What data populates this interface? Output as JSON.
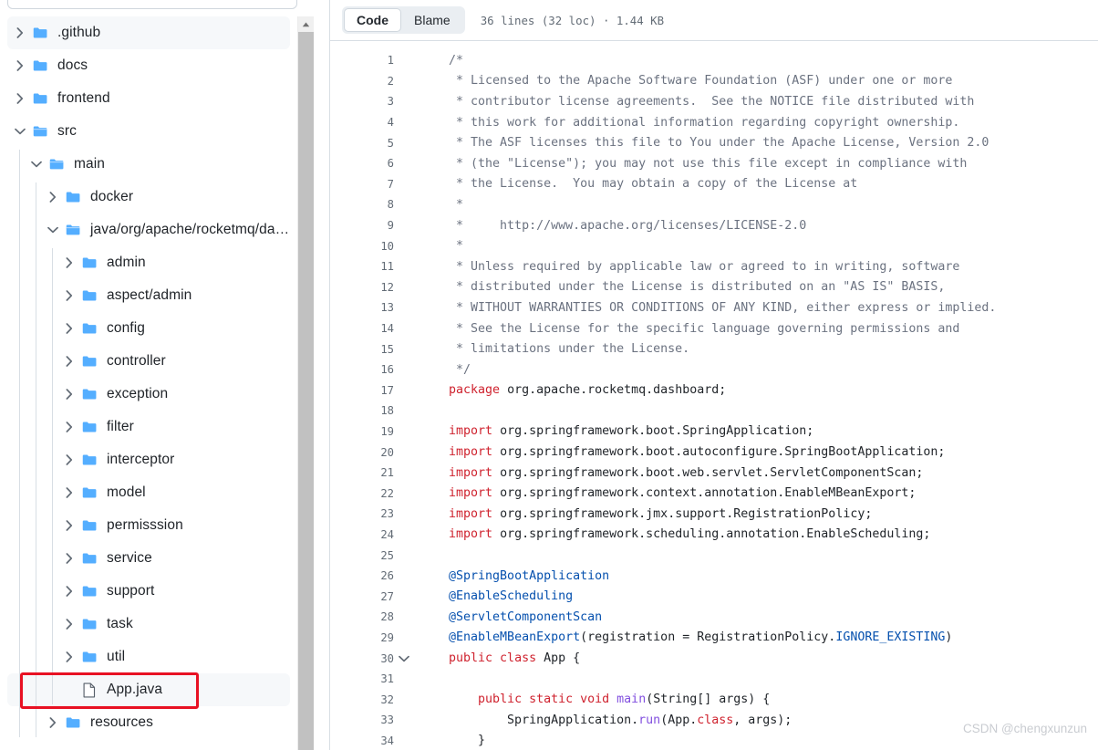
{
  "sidebar": {
    "search": {
      "value": "",
      "placeholder": ""
    },
    "tree": [
      {
        "label": ".github",
        "type": "folder",
        "state": "collapsed",
        "depth": 0,
        "selected": true
      },
      {
        "label": "docs",
        "type": "folder",
        "state": "collapsed",
        "depth": 0,
        "selected": false
      },
      {
        "label": "frontend",
        "type": "folder",
        "state": "collapsed",
        "depth": 0,
        "selected": false
      },
      {
        "label": "src",
        "type": "folder",
        "state": "expanded",
        "depth": 0,
        "selected": false
      },
      {
        "label": "main",
        "type": "folder",
        "state": "expanded",
        "depth": 1,
        "selected": false
      },
      {
        "label": "docker",
        "type": "folder",
        "state": "collapsed",
        "depth": 2,
        "selected": false
      },
      {
        "label": "java/org/apache/rocketmq/da…",
        "type": "folder",
        "state": "expanded",
        "depth": 2,
        "selected": false
      },
      {
        "label": "admin",
        "type": "folder",
        "state": "collapsed",
        "depth": 3,
        "selected": false
      },
      {
        "label": "aspect/admin",
        "type": "folder",
        "state": "collapsed",
        "depth": 3,
        "selected": false
      },
      {
        "label": "config",
        "type": "folder",
        "state": "collapsed",
        "depth": 3,
        "selected": false
      },
      {
        "label": "controller",
        "type": "folder",
        "state": "collapsed",
        "depth": 3,
        "selected": false
      },
      {
        "label": "exception",
        "type": "folder",
        "state": "collapsed",
        "depth": 3,
        "selected": false
      },
      {
        "label": "filter",
        "type": "folder",
        "state": "collapsed",
        "depth": 3,
        "selected": false
      },
      {
        "label": "interceptor",
        "type": "folder",
        "state": "collapsed",
        "depth": 3,
        "selected": false
      },
      {
        "label": "model",
        "type": "folder",
        "state": "collapsed",
        "depth": 3,
        "selected": false
      },
      {
        "label": "permisssion",
        "type": "folder",
        "state": "collapsed",
        "depth": 3,
        "selected": false
      },
      {
        "label": "service",
        "type": "folder",
        "state": "collapsed",
        "depth": 3,
        "selected": false
      },
      {
        "label": "support",
        "type": "folder",
        "state": "collapsed",
        "depth": 3,
        "selected": false
      },
      {
        "label": "task",
        "type": "folder",
        "state": "collapsed",
        "depth": 3,
        "selected": false
      },
      {
        "label": "util",
        "type": "folder",
        "state": "collapsed",
        "depth": 3,
        "selected": false
      },
      {
        "label": "App.java",
        "type": "file",
        "state": "none",
        "depth": 3,
        "selected": true
      },
      {
        "label": "resources",
        "type": "folder",
        "state": "collapsed",
        "depth": 2,
        "selected": false
      }
    ],
    "annotation": {
      "color": "#e81123",
      "target": "App.java"
    },
    "scrollbar": {
      "up_icon": "scroll-up-arrow"
    }
  },
  "code_view": {
    "tabs": [
      {
        "label": "Code",
        "active": true
      },
      {
        "label": "Blame",
        "active": false
      }
    ],
    "meta": "36 lines (32 loc) · 1.44 KB",
    "lines": [
      {
        "n": 1,
        "fold": false,
        "tokens": [
          {
            "t": "  ",
            "c": "pl"
          },
          {
            "t": "/*",
            "c": "com"
          }
        ]
      },
      {
        "n": 2,
        "fold": false,
        "tokens": [
          {
            "t": "   * Licensed to the Apache Software Foundation (ASF) under one or more",
            "c": "com"
          }
        ]
      },
      {
        "n": 3,
        "fold": false,
        "tokens": [
          {
            "t": "   * contributor license agreements.  See the NOTICE file distributed with",
            "c": "com"
          }
        ]
      },
      {
        "n": 4,
        "fold": false,
        "tokens": [
          {
            "t": "   * this work for additional information regarding copyright ownership.",
            "c": "com"
          }
        ]
      },
      {
        "n": 5,
        "fold": false,
        "tokens": [
          {
            "t": "   * The ASF licenses this file to You under the Apache License, Version 2.0",
            "c": "com"
          }
        ]
      },
      {
        "n": 6,
        "fold": false,
        "tokens": [
          {
            "t": "   * (the \"License\"); you may not use this file except in compliance with",
            "c": "com"
          }
        ]
      },
      {
        "n": 7,
        "fold": false,
        "tokens": [
          {
            "t": "   * the License.  You may obtain a copy of the License at",
            "c": "com"
          }
        ]
      },
      {
        "n": 8,
        "fold": false,
        "tokens": [
          {
            "t": "   *",
            "c": "com"
          }
        ]
      },
      {
        "n": 9,
        "fold": false,
        "tokens": [
          {
            "t": "   *     http://www.apache.org/licenses/LICENSE-2.0",
            "c": "com"
          }
        ]
      },
      {
        "n": 10,
        "fold": false,
        "tokens": [
          {
            "t": "   *",
            "c": "com"
          }
        ]
      },
      {
        "n": 11,
        "fold": false,
        "tokens": [
          {
            "t": "   * Unless required by applicable law or agreed to in writing, software",
            "c": "com"
          }
        ]
      },
      {
        "n": 12,
        "fold": false,
        "tokens": [
          {
            "t": "   * distributed under the License is distributed on an \"AS IS\" BASIS,",
            "c": "com"
          }
        ]
      },
      {
        "n": 13,
        "fold": false,
        "tokens": [
          {
            "t": "   * WITHOUT WARRANTIES OR CONDITIONS OF ANY KIND, either express or implied.",
            "c": "com"
          }
        ]
      },
      {
        "n": 14,
        "fold": false,
        "tokens": [
          {
            "t": "   * See the License for the specific language governing permissions and",
            "c": "com"
          }
        ]
      },
      {
        "n": 15,
        "fold": false,
        "tokens": [
          {
            "t": "   * limitations under the License.",
            "c": "com"
          }
        ]
      },
      {
        "n": 16,
        "fold": false,
        "tokens": [
          {
            "t": "   */",
            "c": "com"
          }
        ]
      },
      {
        "n": 17,
        "fold": false,
        "tokens": [
          {
            "t": "  ",
            "c": "pl"
          },
          {
            "t": "package",
            "c": "kw"
          },
          {
            "t": " org.apache.rocketmq.dashboard;",
            "c": "pl"
          }
        ]
      },
      {
        "n": 18,
        "fold": false,
        "tokens": []
      },
      {
        "n": 19,
        "fold": false,
        "tokens": [
          {
            "t": "  ",
            "c": "pl"
          },
          {
            "t": "import",
            "c": "kw"
          },
          {
            "t": " org.springframework.boot.SpringApplication;",
            "c": "pl"
          }
        ]
      },
      {
        "n": 20,
        "fold": false,
        "tokens": [
          {
            "t": "  ",
            "c": "pl"
          },
          {
            "t": "import",
            "c": "kw"
          },
          {
            "t": " org.springframework.boot.autoconfigure.SpringBootApplication;",
            "c": "pl"
          }
        ]
      },
      {
        "n": 21,
        "fold": false,
        "tokens": [
          {
            "t": "  ",
            "c": "pl"
          },
          {
            "t": "import",
            "c": "kw"
          },
          {
            "t": " org.springframework.boot.web.servlet.ServletComponentScan;",
            "c": "pl"
          }
        ]
      },
      {
        "n": 22,
        "fold": false,
        "tokens": [
          {
            "t": "  ",
            "c": "pl"
          },
          {
            "t": "import",
            "c": "kw"
          },
          {
            "t": " org.springframework.context.annotation.EnableMBeanExport;",
            "c": "pl"
          }
        ]
      },
      {
        "n": 23,
        "fold": false,
        "tokens": [
          {
            "t": "  ",
            "c": "pl"
          },
          {
            "t": "import",
            "c": "kw"
          },
          {
            "t": " org.springframework.jmx.support.RegistrationPolicy;",
            "c": "pl"
          }
        ]
      },
      {
        "n": 24,
        "fold": false,
        "tokens": [
          {
            "t": "  ",
            "c": "pl"
          },
          {
            "t": "import",
            "c": "kw"
          },
          {
            "t": " org.springframework.scheduling.annotation.EnableScheduling;",
            "c": "pl"
          }
        ]
      },
      {
        "n": 25,
        "fold": false,
        "tokens": []
      },
      {
        "n": 26,
        "fold": false,
        "tokens": [
          {
            "t": "  ",
            "c": "pl"
          },
          {
            "t": "@SpringBootApplication",
            "c": "ann"
          }
        ]
      },
      {
        "n": 27,
        "fold": false,
        "tokens": [
          {
            "t": "  ",
            "c": "pl"
          },
          {
            "t": "@EnableScheduling",
            "c": "ann"
          }
        ]
      },
      {
        "n": 28,
        "fold": false,
        "tokens": [
          {
            "t": "  ",
            "c": "pl"
          },
          {
            "t": "@ServletComponentScan",
            "c": "ann"
          }
        ]
      },
      {
        "n": 29,
        "fold": false,
        "tokens": [
          {
            "t": "  ",
            "c": "pl"
          },
          {
            "t": "@EnableMBeanExport",
            "c": "ann"
          },
          {
            "t": "(registration = RegistrationPolicy.",
            "c": "pl"
          },
          {
            "t": "IGNORE_EXISTING",
            "c": "con"
          },
          {
            "t": ")",
            "c": "pl"
          }
        ]
      },
      {
        "n": 30,
        "fold": true,
        "tokens": [
          {
            "t": "  ",
            "c": "pl"
          },
          {
            "t": "public class",
            "c": "kw"
          },
          {
            "t": " App {",
            "c": "pl"
          }
        ]
      },
      {
        "n": 31,
        "fold": false,
        "tokens": []
      },
      {
        "n": 32,
        "fold": false,
        "tokens": [
          {
            "t": "      ",
            "c": "pl"
          },
          {
            "t": "public static void",
            "c": "kw"
          },
          {
            "t": " ",
            "c": "pl"
          },
          {
            "t": "main",
            "c": "fn"
          },
          {
            "t": "(String[] args) {",
            "c": "pl"
          }
        ]
      },
      {
        "n": 33,
        "fold": false,
        "tokens": [
          {
            "t": "          SpringApplication.",
            "c": "pl"
          },
          {
            "t": "run",
            "c": "fn"
          },
          {
            "t": "(App.",
            "c": "pl"
          },
          {
            "t": "class",
            "c": "kw"
          },
          {
            "t": ", args);",
            "c": "pl"
          }
        ]
      },
      {
        "n": 34,
        "fold": false,
        "tokens": [
          {
            "t": "      }",
            "c": "pl"
          }
        ]
      }
    ]
  },
  "watermark": "CSDN @chengxunzun"
}
